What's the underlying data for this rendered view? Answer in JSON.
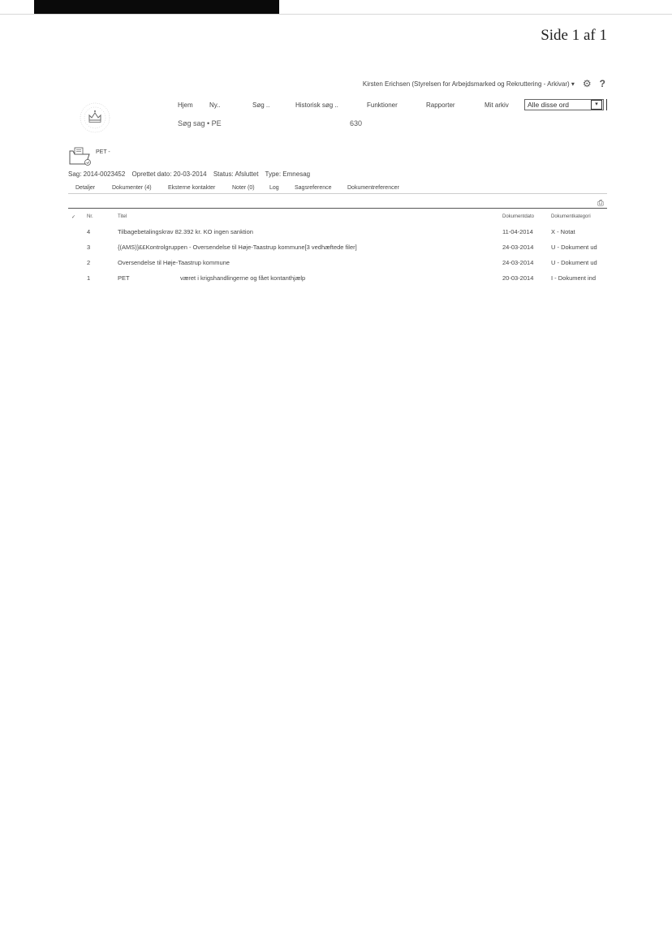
{
  "page": {
    "number": "Side 1 af 1"
  },
  "user_bar": {
    "user": "Kirsten Erichsen (Styrelsen for Arbejdsmarked og Rekruttering - Arkivar) ▾",
    "gear": "⚙",
    "help": "?"
  },
  "nav": {
    "items": [
      "Hjem",
      "Ny..",
      "Søg ..",
      "Historisk søg ..",
      "Funktioner",
      "Rapporter",
      "Mit arkiv"
    ]
  },
  "search": {
    "value": "Alle disse ord",
    "arrow": "▾"
  },
  "breadcrumb": {
    "left": "Søg sag  •  PE",
    "right": "630"
  },
  "case": {
    "title": "PET -",
    "meta": [
      "Sag: 2014-0023452",
      "Oprettet dato: 20-03-2014",
      "Status: Afsluttet",
      "Type: Emnesag"
    ]
  },
  "tabs": [
    "Detaljer",
    "Dokumenter (4)",
    "Eksterne kontakter",
    "Noter (0)",
    "Log",
    "Sagsreference",
    "Dokumentreferencer"
  ],
  "table": {
    "check": "✓",
    "headers": [
      "Nr.",
      "Titel",
      "Dokumentdato",
      "Dokumentkategori"
    ],
    "rows": [
      {
        "nr": "4",
        "title": "Tilbagebetalingskrav 82.392 kr. KO ingen sanktion",
        "date": "11-04-2014",
        "category": "X - Notat"
      },
      {
        "nr": "3",
        "title": "{(AMS)}££Kontrolgruppen - Oversendelse til Høje-Taastrup kommune[3 vedhæftede filer]",
        "date": "24-03-2014",
        "category": "U - Dokument ud"
      },
      {
        "nr": "2",
        "title": "Oversendelse til Høje-Taastrup kommune",
        "date": "24-03-2014",
        "category": "U - Dokument ud"
      },
      {
        "nr": "1",
        "title": "PET                              været i krigshandlingerne og fået kontanthjælp",
        "date": "20-03-2014",
        "category": "I - Dokument ind"
      }
    ]
  }
}
